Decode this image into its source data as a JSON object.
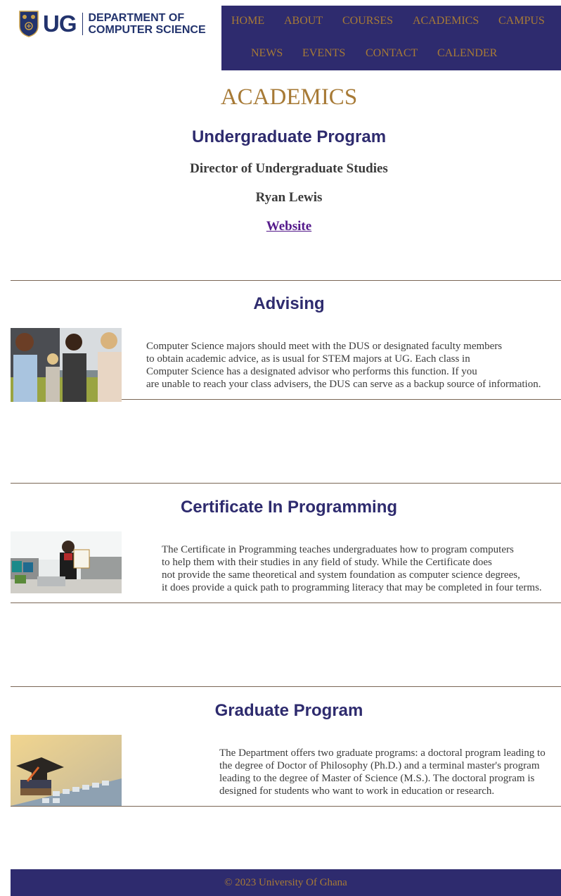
{
  "header": {
    "logo_short": "UG",
    "logo_line1": "DEPARTMENT OF",
    "logo_line2": "COMPUTER SCIENCE"
  },
  "nav": {
    "items": [
      "HOME",
      "ABOUT",
      "COURSES",
      "ACADEMICS",
      "CAMPUS",
      "NEWS",
      "EVENTS",
      "CONTACT",
      "CALENDER"
    ]
  },
  "page": {
    "title": "ACADEMICS"
  },
  "undergrad": {
    "heading": "Undergraduate Program",
    "director_label": "Director of Undergraduate Studies",
    "director_name": "Ryan Lewis",
    "website_link": "Website"
  },
  "advising": {
    "heading": "Advising",
    "image": "students-group-photo",
    "lines": [
      "Computer Science majors should meet with the DUS or designated faculty members",
      "to obtain academic advice, as is usual for STEM majors at UG. Each class in",
      "Computer Science has a designated advisor who performs this function. If you",
      "are unable to reach your class advisers, the DUS can serve as a backup source of information."
    ]
  },
  "certificate": {
    "heading": "Certificate In Programming",
    "image": "graduate-with-certificate-photo",
    "lines": [
      "The Certificate in Programming teaches undergraduates how to program computers",
      "to help them with their studies in any field of study. While the Certificate does",
      "not provide the same theoretical and system foundation as computer science degrees,",
      "it does provide a quick path to programming literacy that may be completed in four terms."
    ]
  },
  "graduate": {
    "heading": "Graduate Program",
    "image": "graduation-cap-on-keyboard-photo",
    "lines": [
      "The Department offers two graduate programs: a doctoral program leading to",
      "the degree of Doctor of Philosophy (Ph.D.) and a terminal master's program",
      "leading to the degree of Master of Science (M.S.). The doctoral program is",
      "designed for students who want to work in education or research."
    ]
  },
  "footer": {
    "text": "© 2023 University Of Ghana"
  },
  "colors": {
    "nav_bg": "#2e2b6e",
    "accent_gold": "#a77a36",
    "heading_navy": "#2e2b6e",
    "link_purple": "#551a8b"
  }
}
